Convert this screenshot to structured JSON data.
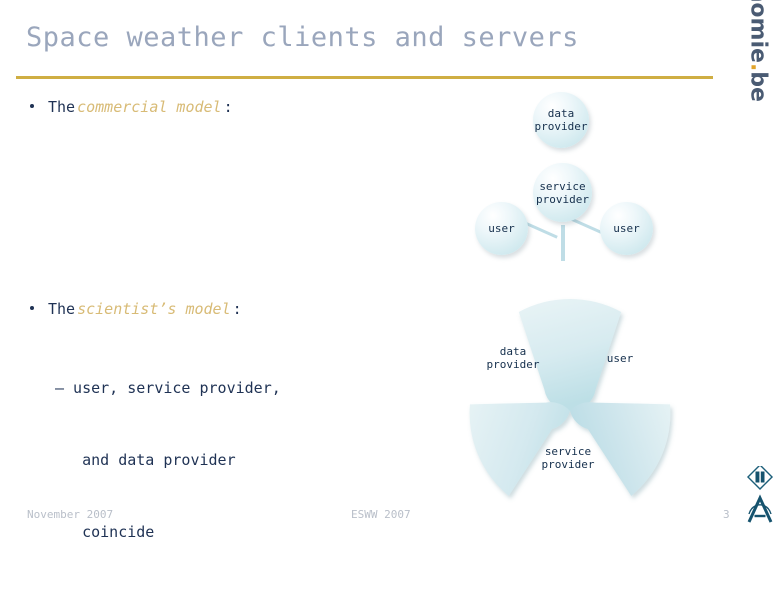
{
  "slide": {
    "title": "Space weather clients and servers",
    "accent_rule_color": "#cfae43",
    "title_color": "#9aa6bc",
    "body_color": "#1f3254",
    "emphasis_color": "#d8bb76",
    "node_fill_color": "#d4ebf0"
  },
  "body": {
    "bullet1": {
      "prefix": "The ",
      "emphasis": "commercial model",
      "suffix": ":"
    },
    "bullet2": {
      "prefix": "The ",
      "emphasis": "scientist’s model",
      "suffix": ":"
    },
    "sub_bullets": [
      "– user, service provider,",
      "   and data provider",
      "   coincide"
    ]
  },
  "diagram_circles": {
    "name": "commercial-model-diagram",
    "nodes": [
      {
        "id": "data-provider",
        "label": "data\nprovider"
      },
      {
        "id": "service-provider",
        "label": "service\nprovider"
      },
      {
        "id": "user-left",
        "label": "user"
      },
      {
        "id": "user-right",
        "label": "user"
      }
    ]
  },
  "diagram_wedges": {
    "name": "scientist-model-diagram",
    "labels": [
      {
        "id": "data-provider",
        "label": "data\nprovider"
      },
      {
        "id": "user",
        "label": "user"
      },
      {
        "id": "service-provider",
        "label": "service\nprovider"
      }
    ]
  },
  "brand": {
    "name_main": "aeronomie",
    "dot": ".",
    "tld": "be"
  },
  "footer": {
    "date": "November 2007",
    "event": "ESWW 2007",
    "page": "3"
  }
}
